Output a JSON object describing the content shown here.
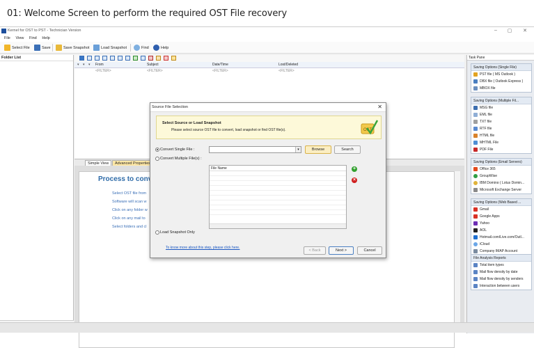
{
  "caption": "01: Welcome Screen to perform the required OST File recovery",
  "window": {
    "title": "Kernel for OST to PST - Technician Version",
    "controls": [
      "–",
      "▢",
      "✕"
    ]
  },
  "menu": [
    "File",
    "View",
    "Find",
    "Help"
  ],
  "toolbar": {
    "select_file": "Select File",
    "save": "Save",
    "save_snapshot": "Save Snapshot",
    "load_snapshot": "Load Snapshot",
    "find": "Find",
    "help": "Help"
  },
  "folder_list": {
    "header": "Folder List"
  },
  "mail_grid": {
    "columns": [
      "From",
      "Subject",
      "Date/Time",
      "Lost/Deleted"
    ],
    "filter_placeholder": "<FILTER>"
  },
  "tabs": [
    "Simple View",
    "Advanced Properties"
  ],
  "content": {
    "title": "Process to conv",
    "steps": [
      "Select OST file from",
      "Software will scan w",
      "Click on any folder w",
      "Click on any mail to",
      "Select folders and cl"
    ]
  },
  "task_pane": {
    "title": "Task Pane",
    "groups": [
      {
        "header": "Saving Options (Single File)",
        "items": [
          "PST file ( MS Outlook )",
          "DBX file ( Outlook Express )",
          "MBOX file"
        ]
      },
      {
        "header": "Saving Options (Multiple Fil...",
        "items": [
          "MSG file",
          "EML file",
          "TXT file",
          "RTF file",
          "HTML file",
          "MHTML File",
          "PDF File"
        ]
      },
      {
        "header": "Saving Options (Email Servers)",
        "items": [
          "Office 365",
          "GroupWise",
          "IBM Domino ( Lotus Domin...",
          "Microsoft Exchange Server"
        ]
      },
      {
        "header": "Saving Options (Web Based ...",
        "items": [
          "Gmail",
          "Google Apps",
          "Yahoo",
          "AOL",
          "Hotmail.com/Live.com/Outl...",
          "iCloud",
          "Company IMAP Account"
        ]
      },
      {
        "header": "File Analysis Reports",
        "items": [
          "Total item types",
          "Mail flow density by date",
          "Mail flow density by senders",
          "Interaction between users"
        ]
      }
    ]
  },
  "dialog": {
    "title": "Source File Selection",
    "close": "✕",
    "banner_heading": "Select Source or Load Snapshot",
    "banner_sub": "Please select source OST file to convert, load snapshot or find OST file(s).",
    "logo_text": "OST",
    "convert_single": "Convert Single File :",
    "convert_multiple": "Convert Multiple File(s) :",
    "browse": "Browse",
    "search": "Search",
    "file_name_col": "File Name",
    "load_snapshot_only": "Load Snapshot Only",
    "know_more": "To know more about this step, please click here.",
    "back": "< Back",
    "next": "Next >",
    "cancel": "Cancel"
  }
}
